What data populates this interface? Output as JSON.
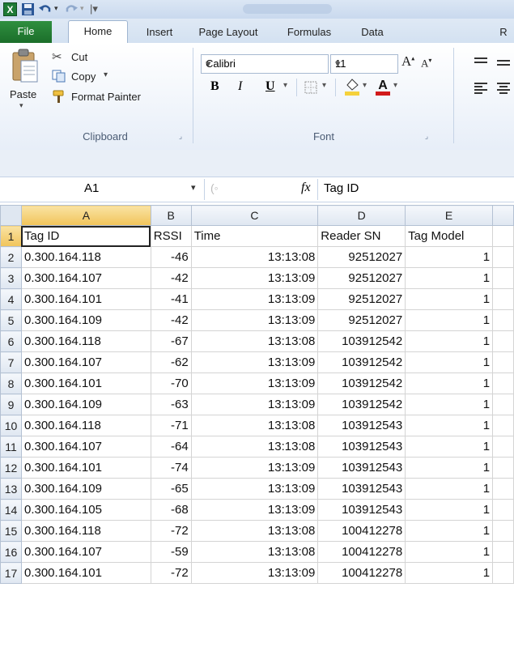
{
  "window": {
    "quick_access": [
      "excel-app-icon",
      "save-icon",
      "undo-icon",
      "redo-icon",
      "customize-icon"
    ]
  },
  "ribbon_tabs": [
    "File",
    "Home",
    "Insert",
    "Page Layout",
    "Formulas",
    "Data",
    "R"
  ],
  "clipboard": {
    "paste": "Paste",
    "cut": "Cut",
    "copy": "Copy",
    "format_painter": "Format Painter",
    "group_label": "Clipboard"
  },
  "font": {
    "name": "Calibri",
    "size": "11",
    "bold": "B",
    "italic": "I",
    "underline": "U",
    "group_label": "Font",
    "fill_color": "#f5d13b",
    "font_color": "#d11a1a"
  },
  "formula_bar": {
    "name_box": "A1",
    "fx": "fx",
    "content": "Tag ID"
  },
  "sheet": {
    "columns": [
      "A",
      "B",
      "C",
      "D",
      "E"
    ],
    "rows": [
      {
        "n": "1",
        "a": "Tag ID",
        "b": "RSSI",
        "c": "Time",
        "d": "Reader SN",
        "e": "Tag Model"
      },
      {
        "n": "2",
        "a": "0.300.164.118",
        "b": "-46",
        "c": "13:13:08",
        "d": "92512027",
        "e": "1"
      },
      {
        "n": "3",
        "a": "0.300.164.107",
        "b": "-42",
        "c": "13:13:09",
        "d": "92512027",
        "e": "1"
      },
      {
        "n": "4",
        "a": "0.300.164.101",
        "b": "-41",
        "c": "13:13:09",
        "d": "92512027",
        "e": "1"
      },
      {
        "n": "5",
        "a": "0.300.164.109",
        "b": "-42",
        "c": "13:13:09",
        "d": "92512027",
        "e": "1"
      },
      {
        "n": "6",
        "a": "0.300.164.118",
        "b": "-67",
        "c": "13:13:08",
        "d": "103912542",
        "e": "1"
      },
      {
        "n": "7",
        "a": "0.300.164.107",
        "b": "-62",
        "c": "13:13:09",
        "d": "103912542",
        "e": "1"
      },
      {
        "n": "8",
        "a": "0.300.164.101",
        "b": "-70",
        "c": "13:13:09",
        "d": "103912542",
        "e": "1"
      },
      {
        "n": "9",
        "a": "0.300.164.109",
        "b": "-63",
        "c": "13:13:09",
        "d": "103912542",
        "e": "1"
      },
      {
        "n": "10",
        "a": "0.300.164.118",
        "b": "-71",
        "c": "13:13:08",
        "d": "103912543",
        "e": "1"
      },
      {
        "n": "11",
        "a": "0.300.164.107",
        "b": "-64",
        "c": "13:13:08",
        "d": "103912543",
        "e": "1"
      },
      {
        "n": "12",
        "a": "0.300.164.101",
        "b": "-74",
        "c": "13:13:09",
        "d": "103912543",
        "e": "1"
      },
      {
        "n": "13",
        "a": "0.300.164.109",
        "b": "-65",
        "c": "13:13:09",
        "d": "103912543",
        "e": "1"
      },
      {
        "n": "14",
        "a": "0.300.164.105",
        "b": "-68",
        "c": "13:13:09",
        "d": "103912543",
        "e": "1"
      },
      {
        "n": "15",
        "a": "0.300.164.118",
        "b": "-72",
        "c": "13:13:08",
        "d": "100412278",
        "e": "1"
      },
      {
        "n": "16",
        "a": "0.300.164.107",
        "b": "-59",
        "c": "13:13:08",
        "d": "100412278",
        "e": "1"
      },
      {
        "n": "17",
        "a": "0.300.164.101",
        "b": "-72",
        "c": "13:13:09",
        "d": "100412278",
        "e": "1"
      }
    ]
  }
}
